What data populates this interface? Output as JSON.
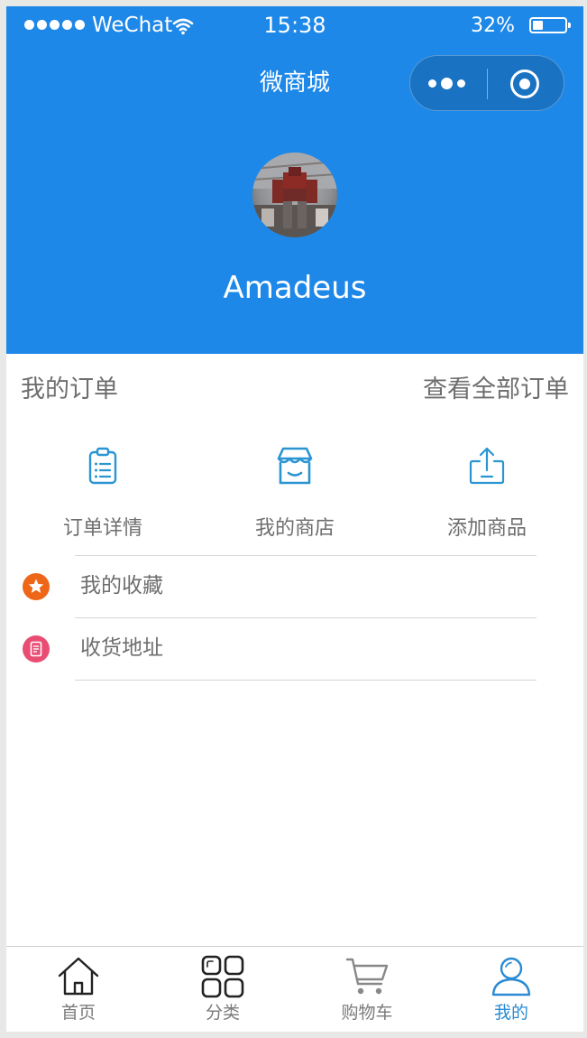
{
  "status_bar": {
    "carrier": "WeChat",
    "time": "15:38",
    "battery": "32%",
    "battery_level": 0.32
  },
  "nav": {
    "title": "微商城"
  },
  "profile": {
    "username": "Amadeus"
  },
  "orders": {
    "title": "我的订单",
    "view_all": "查看全部订单",
    "actions": [
      {
        "label": "订单详情",
        "icon": "clipboard-icon"
      },
      {
        "label": "我的商店",
        "icon": "store-icon"
      },
      {
        "label": "添加商品",
        "icon": "upload-icon"
      }
    ]
  },
  "menu": [
    {
      "label": "我的收藏",
      "icon": "star-icon",
      "color": "#ee6618"
    },
    {
      "label": "收货地址",
      "icon": "address-icon",
      "color": "#ea4d73"
    }
  ],
  "tabbar": [
    {
      "label": "首页",
      "icon": "home-icon",
      "active": false
    },
    {
      "label": "分类",
      "icon": "category-icon",
      "active": false
    },
    {
      "label": "购物车",
      "icon": "cart-icon",
      "active": false
    },
    {
      "label": "我的",
      "icon": "user-icon",
      "active": true
    }
  ],
  "colors": {
    "primary": "#1e88e8",
    "accent_icon": "#2a95d2",
    "active_tab": "#2a8bd3",
    "text_muted": "#6e6e6e"
  }
}
